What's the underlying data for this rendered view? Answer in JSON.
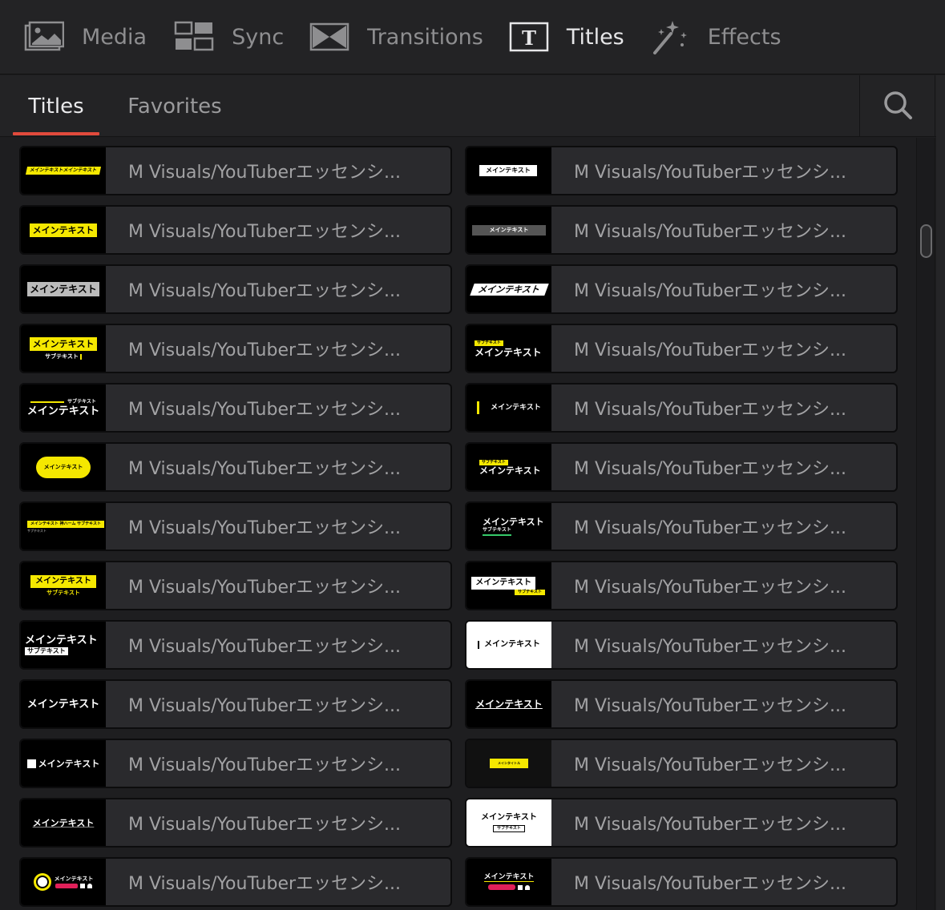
{
  "modules": [
    {
      "label": "Media",
      "icon": "media-icon"
    },
    {
      "label": "Sync",
      "icon": "sync-icon"
    },
    {
      "label": "Transitions",
      "icon": "transitions-icon"
    },
    {
      "label": "Titles",
      "icon": "titles-icon",
      "active": true
    },
    {
      "label": "Effects",
      "icon": "effects-icon"
    }
  ],
  "subtabs": [
    {
      "label": "Titles",
      "active": true
    },
    {
      "label": "Favorites"
    }
  ],
  "item_name": "M Visuals/YouTuberエッセンシ...",
  "thumbs": {
    "main": "メインテキスト",
    "sub": "サブテキスト",
    "main_long": "メインテキストメインテキスト",
    "main_with_line": "メインテキスト 神ハーム サブテキスト",
    "main_title": "メインタイトル",
    "sub_small": "サブテキスト"
  },
  "accent": "#e14a3c",
  "thumb_yellow": "#f5e800"
}
